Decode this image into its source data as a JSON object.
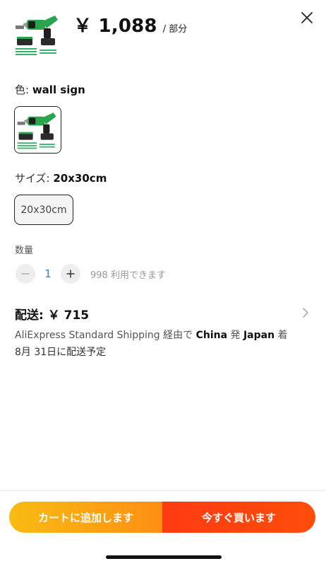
{
  "header": {
    "price": "￥ 1,088",
    "price_unit": "/ 部分",
    "product_image": "reciprocating-saw-product-image",
    "close_icon": "close-icon"
  },
  "color": {
    "label": "色: ",
    "selected": "wall sign",
    "swatch_image": "reciprocating-saw-swatch-image"
  },
  "size": {
    "label": "サイズ: ",
    "selected": "20x30cm",
    "options": [
      "20x30cm"
    ]
  },
  "quantity": {
    "label": "数量",
    "value": "1",
    "stock": "998 利用できます",
    "minus_icon": "minus-icon",
    "plus_icon": "plus-icon"
  },
  "shipping": {
    "title": "配送: ￥ 715",
    "method_prefix": "AliExpress Standard Shipping 経由で ",
    "origin": "China",
    "from_word": " 発 ",
    "destination": "Japan",
    "to_word": " 着",
    "delivery": "8月 31日に配送予定",
    "chevron_icon": "chevron-right-icon"
  },
  "actions": {
    "cart_label": "カートに追加します",
    "buy_label": "今すぐ買います"
  },
  "colors": {
    "cart_gradient": [
      "#f9bb12",
      "#fd8f14"
    ],
    "buy_gradient": [
      "#fd3b12",
      "#ff4d0a"
    ],
    "quantity_accent": "#2b7de9"
  }
}
